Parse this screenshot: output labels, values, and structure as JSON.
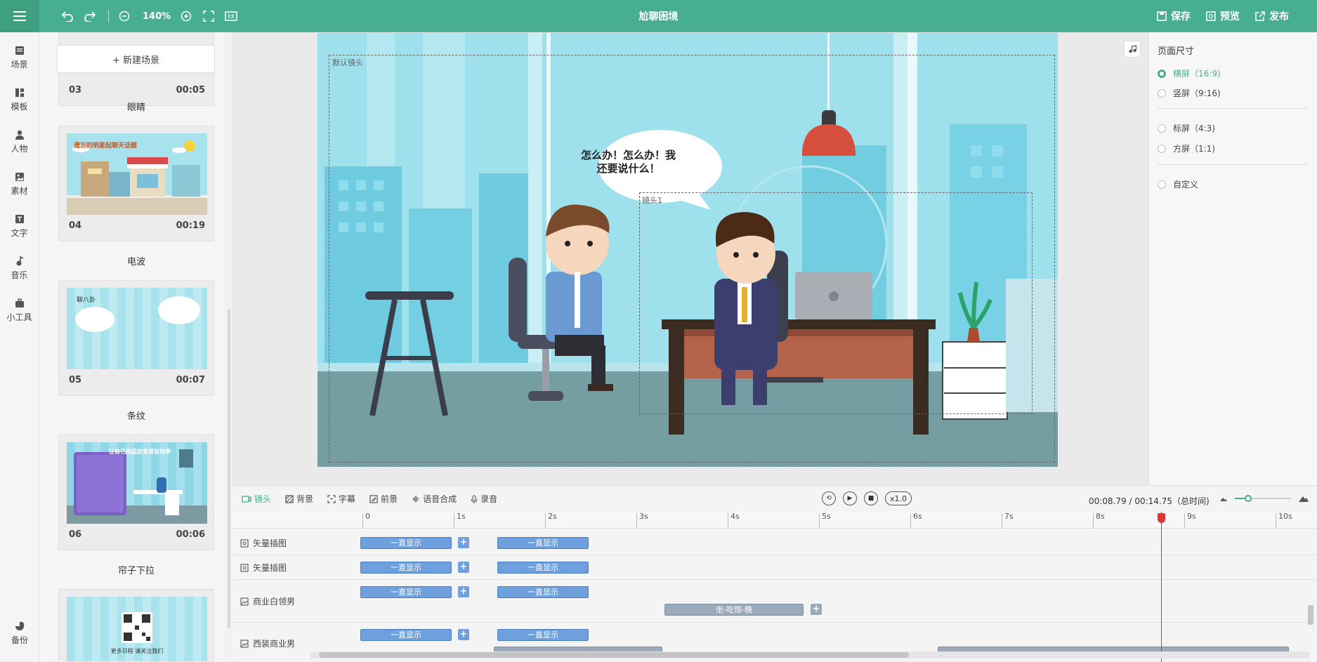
{
  "topbar": {
    "zoom": "140%",
    "title": "尬聊困境",
    "save": "保存",
    "preview": "预览",
    "publish": "发布"
  },
  "nav": {
    "items": [
      "场景",
      "模板",
      "人物",
      "素材",
      "文字",
      "音乐",
      "小工具"
    ],
    "bottom": "备份"
  },
  "scenes": {
    "new_label": "+ 新建场景",
    "partial_top": {
      "num": "03",
      "dur": "00:05"
    },
    "transitions": [
      "眼睛",
      "电波",
      "条纹",
      "帘子下拉"
    ],
    "cards": [
      {
        "num": "04",
        "dur": "00:19",
        "caption": "遗忘的明星起聊天话题"
      },
      {
        "num": "05",
        "dur": "00:07",
        "caption": "聊八卦"
      },
      {
        "num": "06",
        "dur": "00:06",
        "caption": "让自己拖延症变得有效率"
      }
    ],
    "last_card_caption": "更多日程 请关注我们"
  },
  "stage": {
    "default_camera": "默认镜头",
    "camera1": "镜头1",
    "speech": "怎么办！怎么办！我还要说什么！"
  },
  "props": {
    "heading": "页面尺寸",
    "options": [
      {
        "label": "横屏（16:9)",
        "selected": true
      },
      {
        "label": "竖屏（9:16)",
        "selected": false
      },
      {
        "label": "标屏（4:3)",
        "selected": false
      },
      {
        "label": "方屏（1:1)",
        "selected": false
      },
      {
        "label": "自定义",
        "selected": false
      }
    ]
  },
  "timeline": {
    "tabs": [
      "镜头",
      "背景",
      "字幕",
      "前景",
      "语音合成",
      "录音"
    ],
    "speed": "x1.0",
    "time": "00:08.79 / 00:14.75（总时间)",
    "ticks": [
      "0",
      "1s",
      "2s",
      "3s",
      "4s",
      "5s",
      "6s",
      "7s",
      "8s",
      "9s",
      "10s"
    ],
    "tracks": [
      "矢量插图",
      "矢量插图",
      "商业白领男",
      "西装商业男"
    ],
    "clip_always": "一直显示",
    "clip_action": "坐-吃惊-晚"
  },
  "colors": {
    "accent": "#47ae8f",
    "clip": "#6ea0dd",
    "playhead": "#d9363e"
  }
}
